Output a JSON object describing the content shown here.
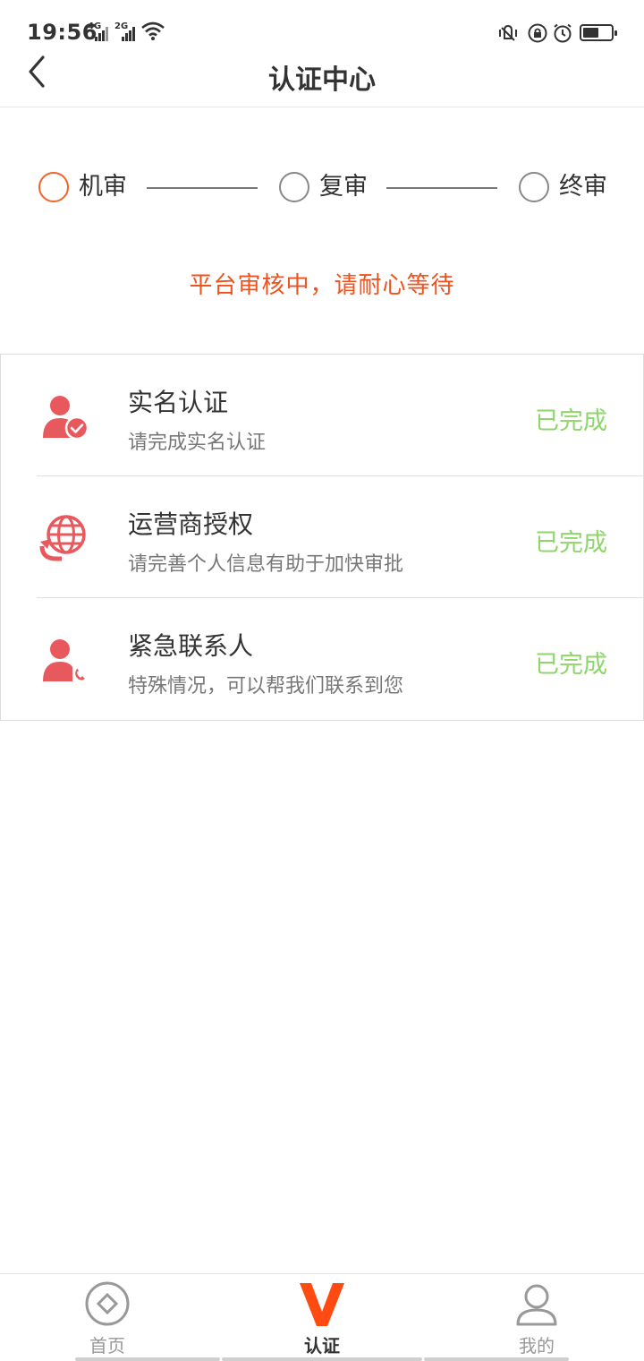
{
  "status_bar": {
    "time": "19:56",
    "network_1": "4G",
    "network_2": "2G"
  },
  "header": {
    "title": "认证中心",
    "back_icon": "chevron-left-icon"
  },
  "steps": [
    {
      "label": "机审",
      "state": "active"
    },
    {
      "label": "复审",
      "state": "pending"
    },
    {
      "label": "终审",
      "state": "pending"
    }
  ],
  "review_message": "平台审核中，请耐心等待",
  "verification_items": [
    {
      "title": "实名认证",
      "subtitle": "请完成实名认证",
      "status": "已完成",
      "icon": "user-check-icon"
    },
    {
      "title": "运营商授权",
      "subtitle": "请完善个人信息有助于加快审批",
      "status": "已完成",
      "icon": "globe-refresh-icon"
    },
    {
      "title": "紧急联系人",
      "subtitle": "特殊情况，可以帮我们联系到您",
      "status": "已完成",
      "icon": "user-phone-icon"
    }
  ],
  "tabbar": {
    "tabs": [
      {
        "label": "首页",
        "icon": "home-diamond-icon"
      },
      {
        "label": "认证",
        "icon": "v-logo-icon",
        "active": true
      },
      {
        "label": "我的",
        "icon": "profile-icon"
      }
    ]
  },
  "colors": {
    "accent": "#f0642a",
    "message": "#f0521e",
    "status_done": "#8fd66a",
    "icon_red": "#e8595e",
    "v_logo": "#ff4a12"
  }
}
